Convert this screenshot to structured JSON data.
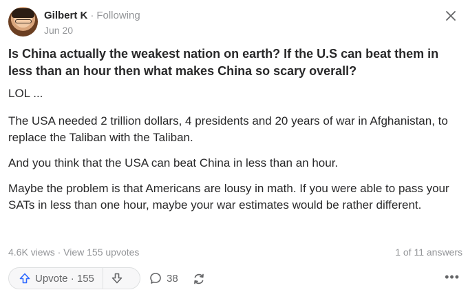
{
  "author": {
    "name": "Gilbert K",
    "separator": "·",
    "follow_status": "Following",
    "date": "Jun 20"
  },
  "question": "Is China actually the weakest nation on earth? If the U.S can beat them in less than an hour then what makes China so scary overall?",
  "answer": {
    "paragraphs": [
      "LOL ...",
      "The USA needed 2 trillion dollars, 4 presidents and 20 years of war in Afghanistan, to replace the Taliban with the Taliban.",
      "And you think that the USA can beat China in less than an hour.",
      "Maybe the problem is that Americans are lousy in math. If you were able to pass your SATs in less than one hour, maybe your war estimates would be rather different."
    ]
  },
  "stats": {
    "views": "4.6K views",
    "separator": "·",
    "upvotes_link": "View 155 upvotes",
    "answer_position": "1 of 11 answers"
  },
  "actions": {
    "upvote_label": "Upvote · 155",
    "comment_count": "38",
    "more_label": "•••"
  },
  "icons": {
    "close": "close-icon",
    "upvote": "arrow-up-icon",
    "downvote": "arrow-down-icon",
    "comment": "comment-bubble-icon",
    "share": "share-arrows-icon",
    "more": "more-dots-icon"
  },
  "colors": {
    "text": "#282829",
    "muted": "#939598",
    "icon": "#636466",
    "upvote_accent": "#2e69ff"
  }
}
